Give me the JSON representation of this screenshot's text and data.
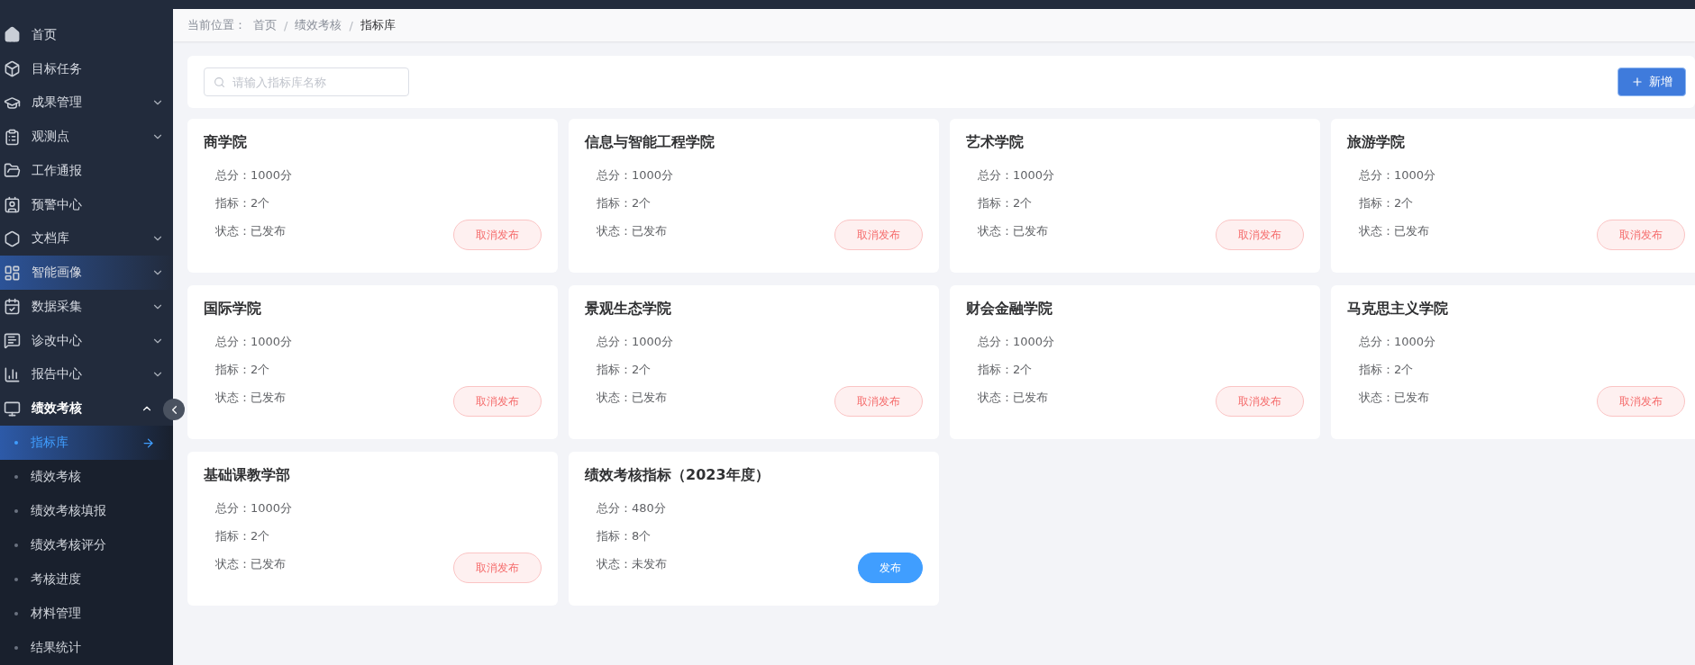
{
  "sidebar": {
    "items": [
      {
        "label": "首页",
        "expandable": false,
        "expanded": false,
        "highlighted": false
      },
      {
        "label": "目标任务",
        "expandable": false,
        "expanded": false,
        "highlighted": false
      },
      {
        "label": "成果管理",
        "expandable": true,
        "expanded": false,
        "highlighted": false
      },
      {
        "label": "观测点",
        "expandable": true,
        "expanded": false,
        "highlighted": false
      },
      {
        "label": "工作通报",
        "expandable": false,
        "expanded": false,
        "highlighted": false
      },
      {
        "label": "预警中心",
        "expandable": false,
        "expanded": false,
        "highlighted": false
      },
      {
        "label": "文档库",
        "expandable": true,
        "expanded": false,
        "highlighted": false
      },
      {
        "label": "智能画像",
        "expandable": true,
        "expanded": false,
        "highlighted": true
      },
      {
        "label": "数据采集",
        "expandable": true,
        "expanded": false,
        "highlighted": false
      },
      {
        "label": "诊改中心",
        "expandable": true,
        "expanded": false,
        "highlighted": false
      },
      {
        "label": "报告中心",
        "expandable": true,
        "expanded": false,
        "highlighted": false
      },
      {
        "label": "绩效考核",
        "expandable": true,
        "expanded": true,
        "highlighted": false,
        "children": [
          {
            "label": "指标库",
            "selected": true
          },
          {
            "label": "绩效考核",
            "selected": false
          },
          {
            "label": "绩效考核填报",
            "selected": false
          },
          {
            "label": "绩效考核评分",
            "selected": false
          },
          {
            "label": "考核进度",
            "selected": false
          },
          {
            "label": "材料管理",
            "selected": false
          },
          {
            "label": "结果统计",
            "selected": false
          }
        ]
      }
    ]
  },
  "breadcrumb": {
    "prefix": "当前位置：",
    "separator": "/",
    "items": [
      "首页",
      "绩效考核",
      "指标库"
    ]
  },
  "toolbar": {
    "search": {
      "placeholder": "请输入指标库名称"
    },
    "add_button": "新增"
  },
  "cards": [
    {
      "title": "商学院",
      "total": "总分：1000分",
      "count": "指标：2个",
      "status": "状态：已发布",
      "action": {
        "kind": "unpublish",
        "label": "取消发布"
      }
    },
    {
      "title": "信息与智能工程学院",
      "total": "总分：1000分",
      "count": "指标：2个",
      "status": "状态：已发布",
      "action": {
        "kind": "unpublish",
        "label": "取消发布"
      }
    },
    {
      "title": "艺术学院",
      "total": "总分：1000分",
      "count": "指标：2个",
      "status": "状态：已发布",
      "action": {
        "kind": "unpublish",
        "label": "取消发布"
      }
    },
    {
      "title": "旅游学院",
      "total": "总分：1000分",
      "count": "指标：2个",
      "status": "状态：已发布",
      "action": {
        "kind": "unpublish",
        "label": "取消发布"
      }
    },
    {
      "title": "国际学院",
      "total": "总分：1000分",
      "count": "指标：2个",
      "status": "状态：已发布",
      "action": {
        "kind": "unpublish",
        "label": "取消发布"
      }
    },
    {
      "title": "景观生态学院",
      "total": "总分：1000分",
      "count": "指标：2个",
      "status": "状态：已发布",
      "action": {
        "kind": "unpublish",
        "label": "取消发布"
      }
    },
    {
      "title": "财会金融学院",
      "total": "总分：1000分",
      "count": "指标：2个",
      "status": "状态：已发布",
      "action": {
        "kind": "unpublish",
        "label": "取消发布"
      }
    },
    {
      "title": "马克思主义学院",
      "total": "总分：1000分",
      "count": "指标：2个",
      "status": "状态：已发布",
      "action": {
        "kind": "unpublish",
        "label": "取消发布"
      }
    },
    {
      "title": "基础课教学部",
      "total": "总分：1000分",
      "count": "指标：2个",
      "status": "状态：已发布",
      "action": {
        "kind": "unpublish",
        "label": "取消发布"
      }
    },
    {
      "title": "绩效考核指标（2023年度）",
      "total": "总分：480分",
      "count": "指标：8个",
      "status": "状态：未发布",
      "action": {
        "kind": "publish",
        "label": "发布"
      }
    }
  ]
}
